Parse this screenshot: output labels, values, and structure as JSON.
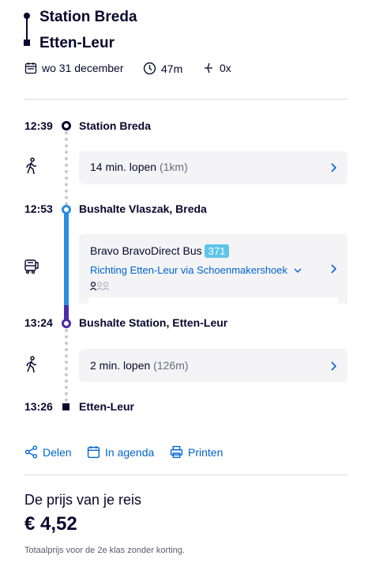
{
  "header": {
    "from": "Station Breda",
    "to": "Etten-Leur",
    "date": "wo 31 december",
    "duration": "47m",
    "transfers": "0x"
  },
  "legs": [
    {
      "time": "12:39",
      "stop": "Station Breda"
    },
    {
      "walk_text": "14 min. lopen",
      "walk_dist": "(1km)"
    },
    {
      "time": "12:53",
      "stop": "Bushalte Vlaszak, Breda"
    },
    {
      "bus_name": "Bravo BravoDirect Bus",
      "bus_line": "371",
      "direction": "Richting Etten-Leur via Schoenmakershoek"
    },
    {
      "time": "13:24",
      "stop": "Bushalte Station, Etten-Leur"
    },
    {
      "walk_text": "2 min. lopen",
      "walk_dist": "(126m)"
    },
    {
      "time": "13:26",
      "stop": "Etten-Leur"
    }
  ],
  "actions": {
    "share": "Delen",
    "agenda": "In agenda",
    "print": "Printen"
  },
  "price": {
    "heading": "De prijs van je reis",
    "amount": "€ 4,52",
    "note": "Totaalprijs voor de 2e klas zonder korting."
  },
  "colors": {
    "text": "#07072d",
    "link": "#0063d3",
    "bus_line_top": "#2b8de0",
    "bus_line_bottom": "#4b2ca8",
    "badge": "#5fc4e8",
    "card_bg": "#f4f4f6"
  }
}
